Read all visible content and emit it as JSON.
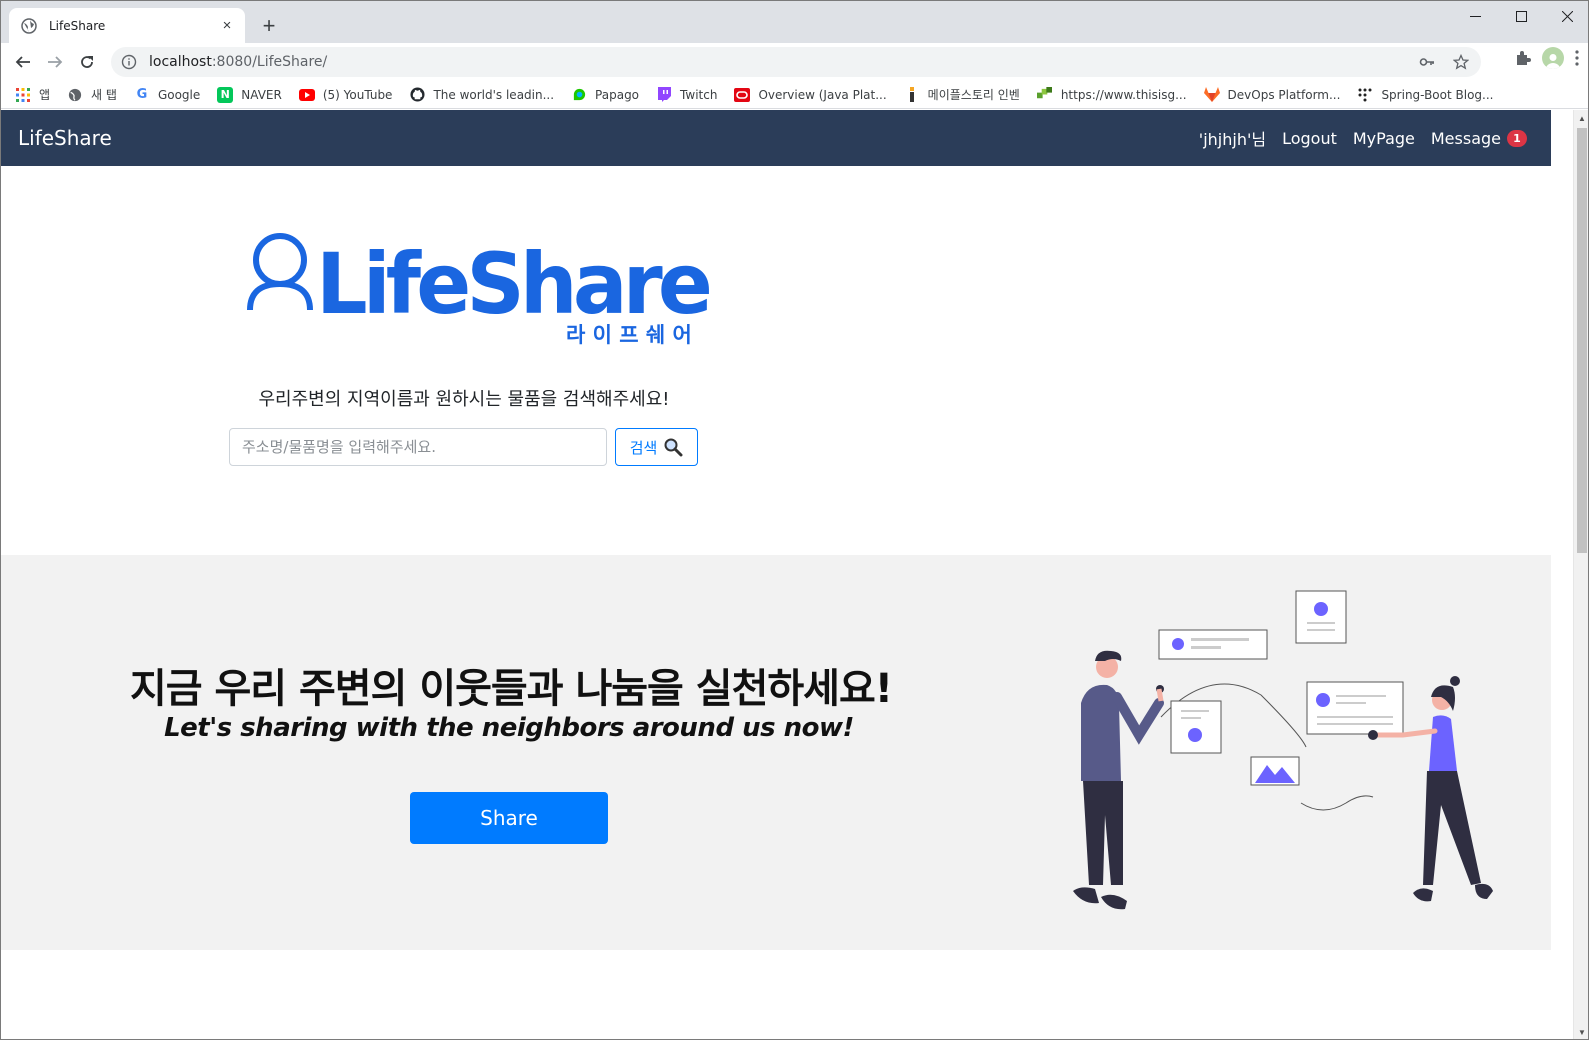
{
  "browser": {
    "tab_title": "LifeShare",
    "tab_close": "×",
    "new_tab": "+",
    "url_host": "localhost",
    "url_rest": ":8080/LifeShare/",
    "bookmarks": [
      {
        "label": "앱",
        "icon": "apps-grid-icon"
      },
      {
        "label": "새 탭",
        "icon": "globe-icon"
      },
      {
        "label": "Google",
        "icon": "google-icon"
      },
      {
        "label": "NAVER",
        "icon": "naver-icon"
      },
      {
        "label": "(5) YouTube",
        "icon": "youtube-icon"
      },
      {
        "label": "The world's leadin...",
        "icon": "github-icon"
      },
      {
        "label": "Papago",
        "icon": "papago-icon"
      },
      {
        "label": "Twitch",
        "icon": "twitch-icon"
      },
      {
        "label": "Overview (Java Plat...",
        "icon": "oracle-icon"
      },
      {
        "label": "메이플스토리 인벤",
        "icon": "inven-icon"
      },
      {
        "label": "https://www.thisisg...",
        "icon": "puzzle-site-icon"
      },
      {
        "label": "DevOps Platform...",
        "icon": "gitlab-icon"
      },
      {
        "label": "Spring-Boot Blog...",
        "icon": "dots-icon"
      }
    ]
  },
  "site": {
    "brand": "LifeShare",
    "nav": {
      "user": "'jhjhjh'님",
      "logout": "Logout",
      "mypage": "MyPage",
      "message": "Message",
      "message_count": "1"
    },
    "logo": {
      "wordmark": "LifeShare",
      "korean": "라 이 프 쉐 어"
    },
    "search": {
      "prompt": "우리주변의 지역이름과 원하시는 물품을 검색해주세요!",
      "placeholder": "주소명/물품명을 입력해주세요.",
      "button_label": "검색"
    },
    "band": {
      "headline": "지금 우리 주변의 이웃들과 나눔을 실천하세요!",
      "subline": "Let's sharing with the neighbors around us now!",
      "share_label": "Share"
    }
  },
  "colors": {
    "navbar": "#2b3d59",
    "primary": "#007bff",
    "logo_blue": "#1a66e0",
    "badge": "#dc3545",
    "band_bg": "#f2f2f2",
    "illus_accent": "#6c63ff"
  }
}
